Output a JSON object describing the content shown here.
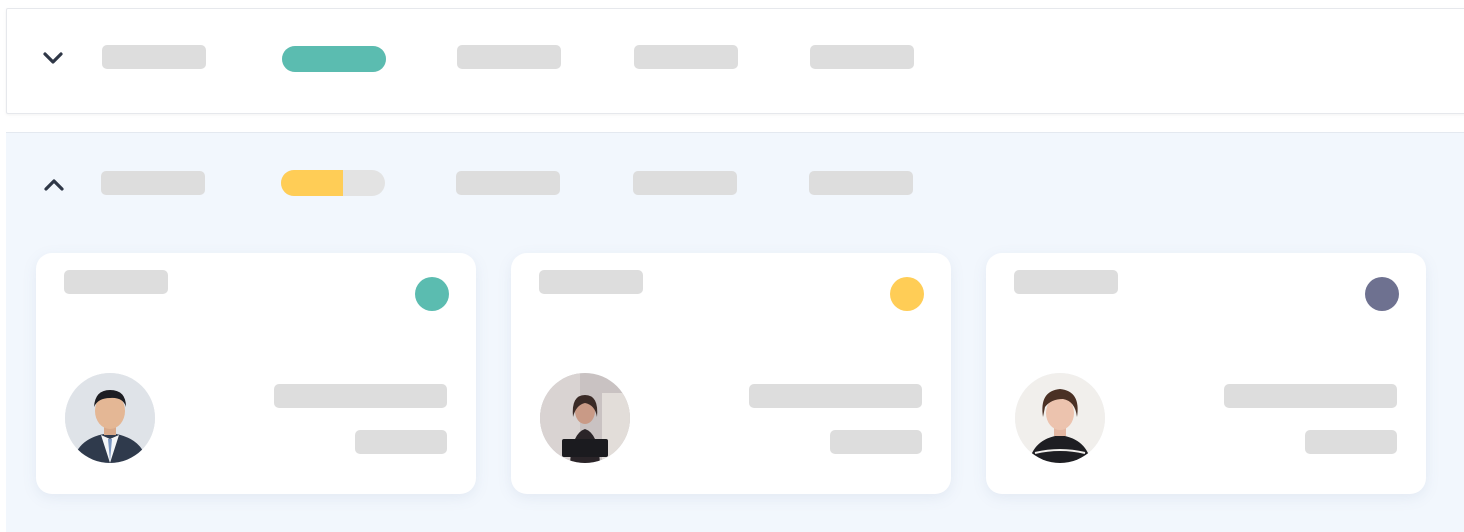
{
  "colors": {
    "teal": "#5bbcb0",
    "yellow": "#ffcd56",
    "slate": "#6e7190",
    "placeholder": "#dddddd",
    "chevron": "#2f3747"
  },
  "rows": [
    {
      "state": "collapsed",
      "toggle_icon": "chevron-down-icon",
      "progress": {
        "fraction": 1.0,
        "color": "#5bbcb0"
      }
    },
    {
      "state": "expanded",
      "toggle_icon": "chevron-up-icon",
      "progress": {
        "fraction": 0.6,
        "color": "#ffcd56"
      },
      "cards": [
        {
          "status_color": "#5bbcb0",
          "avatar": "man-in-suit-avatar"
        },
        {
          "status_color": "#ffcd56",
          "avatar": "woman-with-laptop-avatar"
        },
        {
          "status_color": "#6e7190",
          "avatar": "woman-short-hair-avatar"
        }
      ]
    }
  ]
}
